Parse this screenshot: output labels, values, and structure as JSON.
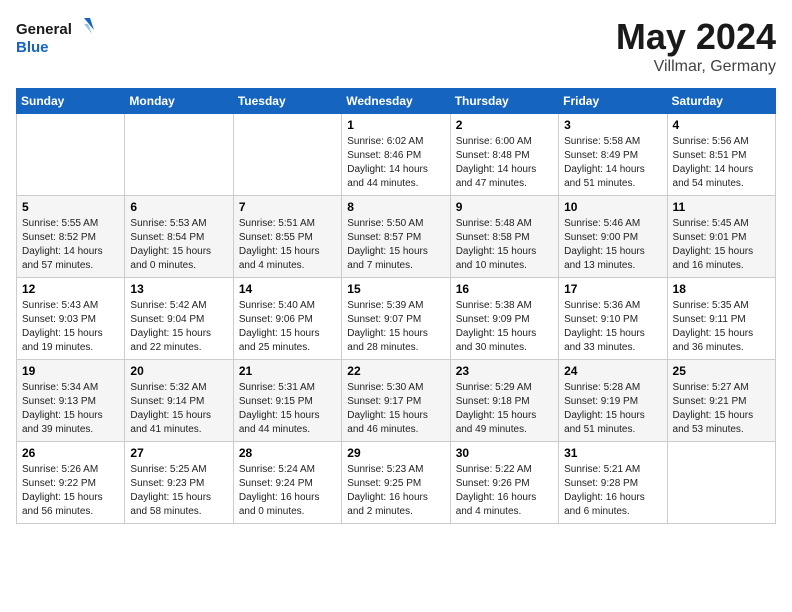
{
  "header": {
    "logo_line1": "General",
    "logo_line2": "Blue",
    "month": "May 2024",
    "location": "Villmar, Germany"
  },
  "weekdays": [
    "Sunday",
    "Monday",
    "Tuesday",
    "Wednesday",
    "Thursday",
    "Friday",
    "Saturday"
  ],
  "weeks": [
    [
      {
        "day": "",
        "info": ""
      },
      {
        "day": "",
        "info": ""
      },
      {
        "day": "",
        "info": ""
      },
      {
        "day": "1",
        "info": "Sunrise: 6:02 AM\nSunset: 8:46 PM\nDaylight: 14 hours\nand 44 minutes."
      },
      {
        "day": "2",
        "info": "Sunrise: 6:00 AM\nSunset: 8:48 PM\nDaylight: 14 hours\nand 47 minutes."
      },
      {
        "day": "3",
        "info": "Sunrise: 5:58 AM\nSunset: 8:49 PM\nDaylight: 14 hours\nand 51 minutes."
      },
      {
        "day": "4",
        "info": "Sunrise: 5:56 AM\nSunset: 8:51 PM\nDaylight: 14 hours\nand 54 minutes."
      }
    ],
    [
      {
        "day": "5",
        "info": "Sunrise: 5:55 AM\nSunset: 8:52 PM\nDaylight: 14 hours\nand 57 minutes."
      },
      {
        "day": "6",
        "info": "Sunrise: 5:53 AM\nSunset: 8:54 PM\nDaylight: 15 hours\nand 0 minutes."
      },
      {
        "day": "7",
        "info": "Sunrise: 5:51 AM\nSunset: 8:55 PM\nDaylight: 15 hours\nand 4 minutes."
      },
      {
        "day": "8",
        "info": "Sunrise: 5:50 AM\nSunset: 8:57 PM\nDaylight: 15 hours\nand 7 minutes."
      },
      {
        "day": "9",
        "info": "Sunrise: 5:48 AM\nSunset: 8:58 PM\nDaylight: 15 hours\nand 10 minutes."
      },
      {
        "day": "10",
        "info": "Sunrise: 5:46 AM\nSunset: 9:00 PM\nDaylight: 15 hours\nand 13 minutes."
      },
      {
        "day": "11",
        "info": "Sunrise: 5:45 AM\nSunset: 9:01 PM\nDaylight: 15 hours\nand 16 minutes."
      }
    ],
    [
      {
        "day": "12",
        "info": "Sunrise: 5:43 AM\nSunset: 9:03 PM\nDaylight: 15 hours\nand 19 minutes."
      },
      {
        "day": "13",
        "info": "Sunrise: 5:42 AM\nSunset: 9:04 PM\nDaylight: 15 hours\nand 22 minutes."
      },
      {
        "day": "14",
        "info": "Sunrise: 5:40 AM\nSunset: 9:06 PM\nDaylight: 15 hours\nand 25 minutes."
      },
      {
        "day": "15",
        "info": "Sunrise: 5:39 AM\nSunset: 9:07 PM\nDaylight: 15 hours\nand 28 minutes."
      },
      {
        "day": "16",
        "info": "Sunrise: 5:38 AM\nSunset: 9:09 PM\nDaylight: 15 hours\nand 30 minutes."
      },
      {
        "day": "17",
        "info": "Sunrise: 5:36 AM\nSunset: 9:10 PM\nDaylight: 15 hours\nand 33 minutes."
      },
      {
        "day": "18",
        "info": "Sunrise: 5:35 AM\nSunset: 9:11 PM\nDaylight: 15 hours\nand 36 minutes."
      }
    ],
    [
      {
        "day": "19",
        "info": "Sunrise: 5:34 AM\nSunset: 9:13 PM\nDaylight: 15 hours\nand 39 minutes."
      },
      {
        "day": "20",
        "info": "Sunrise: 5:32 AM\nSunset: 9:14 PM\nDaylight: 15 hours\nand 41 minutes."
      },
      {
        "day": "21",
        "info": "Sunrise: 5:31 AM\nSunset: 9:15 PM\nDaylight: 15 hours\nand 44 minutes."
      },
      {
        "day": "22",
        "info": "Sunrise: 5:30 AM\nSunset: 9:17 PM\nDaylight: 15 hours\nand 46 minutes."
      },
      {
        "day": "23",
        "info": "Sunrise: 5:29 AM\nSunset: 9:18 PM\nDaylight: 15 hours\nand 49 minutes."
      },
      {
        "day": "24",
        "info": "Sunrise: 5:28 AM\nSunset: 9:19 PM\nDaylight: 15 hours\nand 51 minutes."
      },
      {
        "day": "25",
        "info": "Sunrise: 5:27 AM\nSunset: 9:21 PM\nDaylight: 15 hours\nand 53 minutes."
      }
    ],
    [
      {
        "day": "26",
        "info": "Sunrise: 5:26 AM\nSunset: 9:22 PM\nDaylight: 15 hours\nand 56 minutes."
      },
      {
        "day": "27",
        "info": "Sunrise: 5:25 AM\nSunset: 9:23 PM\nDaylight: 15 hours\nand 58 minutes."
      },
      {
        "day": "28",
        "info": "Sunrise: 5:24 AM\nSunset: 9:24 PM\nDaylight: 16 hours\nand 0 minutes."
      },
      {
        "day": "29",
        "info": "Sunrise: 5:23 AM\nSunset: 9:25 PM\nDaylight: 16 hours\nand 2 minutes."
      },
      {
        "day": "30",
        "info": "Sunrise: 5:22 AM\nSunset: 9:26 PM\nDaylight: 16 hours\nand 4 minutes."
      },
      {
        "day": "31",
        "info": "Sunrise: 5:21 AM\nSunset: 9:28 PM\nDaylight: 16 hours\nand 6 minutes."
      },
      {
        "day": "",
        "info": ""
      }
    ]
  ]
}
